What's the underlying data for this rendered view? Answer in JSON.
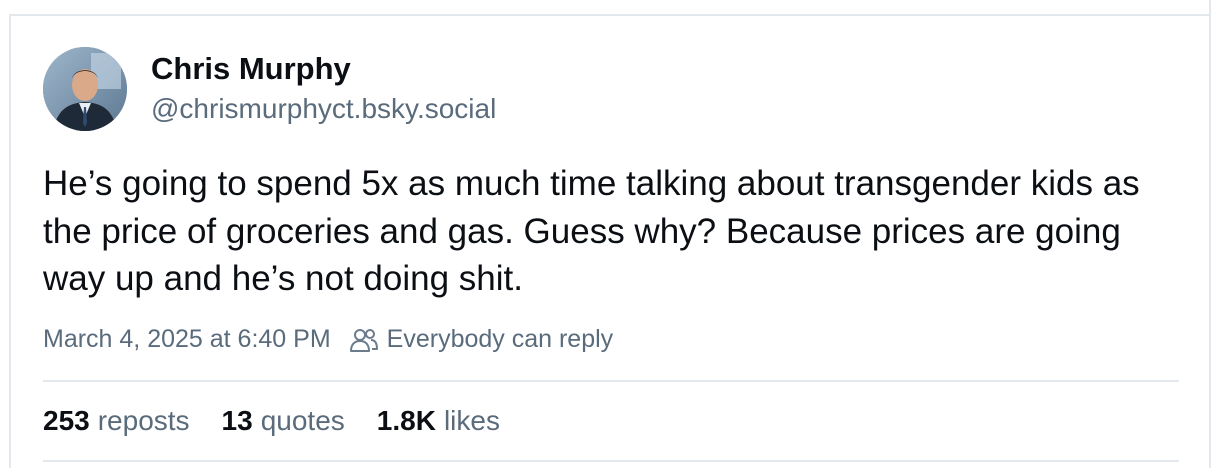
{
  "author": {
    "display_name": "Chris Murphy",
    "handle": "@chrismurphyct.bsky.social"
  },
  "post": {
    "text": "He’s going to spend 5x as much time talking about transgender kids as the price of groceries and gas. Guess why? Because prices are going way up and he’s not doing shit.",
    "timestamp": "March 4, 2025 at 6:40 PM",
    "reply_setting": "Everybody can reply",
    "reply_icon": "people-icon"
  },
  "stats": {
    "reposts_count": "253",
    "reposts_label": "reposts",
    "quotes_count": "13",
    "quotes_label": "quotes",
    "likes_count": "1.8K",
    "likes_label": "likes"
  },
  "colors": {
    "text_primary": "#0b0f14",
    "text_secondary": "#5a6b7c",
    "border": "#e3e8ee",
    "background": "#ffffff"
  }
}
